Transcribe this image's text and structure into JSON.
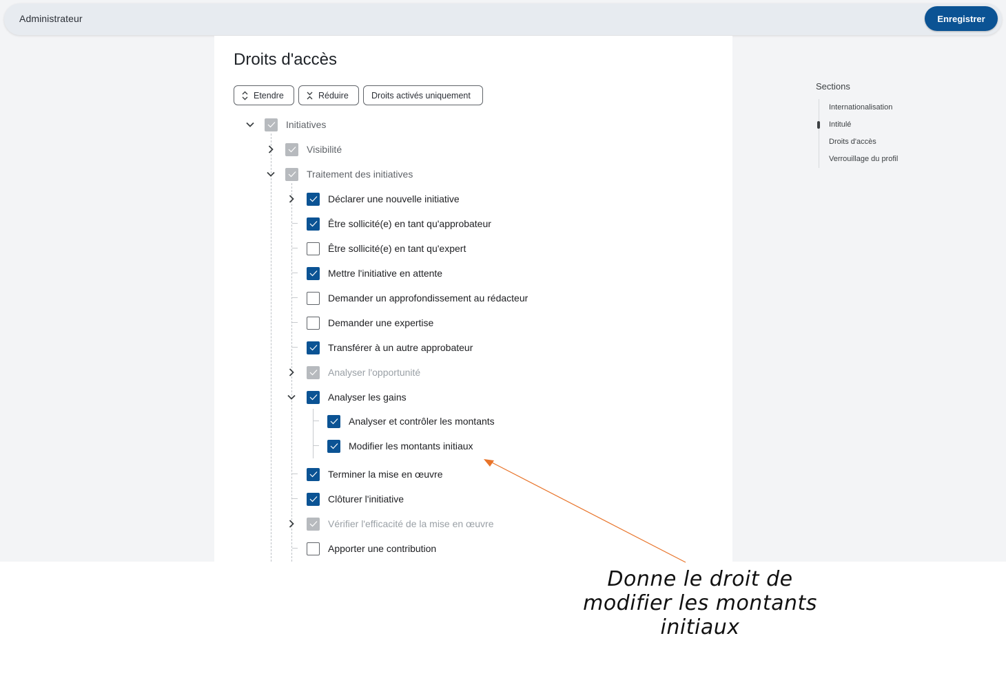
{
  "header": {
    "title": "Administrateur",
    "save_label": "Enregistrer"
  },
  "page": {
    "title": "Droits d'accès"
  },
  "toolbar": {
    "expand_label": "Etendre",
    "collapse_label": "Réduire",
    "active_only_label": "Droits activés uniquement"
  },
  "tree": [
    {
      "label": "Initiatives",
      "state": "grey",
      "chevron": "down",
      "level": 0
    },
    {
      "label": "Visibilité",
      "state": "grey",
      "chevron": "right",
      "level": 1
    },
    {
      "label": "Traitement des initiatives",
      "state": "grey",
      "chevron": "down",
      "level": 1
    },
    {
      "label": "Déclarer une nouvelle initiative",
      "state": "checked",
      "chevron": "right",
      "level": 2
    },
    {
      "label": "Être sollicité(e) en tant qu'approbateur",
      "state": "checked",
      "chevron": "",
      "level": 2
    },
    {
      "label": "Être sollicité(e) en tant qu'expert",
      "state": "unchecked",
      "chevron": "",
      "level": 2
    },
    {
      "label": "Mettre l'initiative en attente",
      "state": "checked",
      "chevron": "",
      "level": 2
    },
    {
      "label": "Demander un approfondissement au rédacteur",
      "state": "unchecked",
      "chevron": "",
      "level": 2
    },
    {
      "label": "Demander une expertise",
      "state": "unchecked",
      "chevron": "",
      "level": 2
    },
    {
      "label": "Transférer à un autre approbateur",
      "state": "checked",
      "chevron": "",
      "level": 2
    },
    {
      "label": "Analyser l'opportunité",
      "state": "disabled",
      "chevron": "right",
      "level": 2
    },
    {
      "label": "Analyser les gains",
      "state": "checked",
      "chevron": "down",
      "level": 2
    },
    {
      "label": "Analyser et contrôler les montants",
      "state": "checked",
      "chevron": "",
      "level": 3
    },
    {
      "label": "Modifier les montants initiaux",
      "state": "checked",
      "chevron": "",
      "level": 3
    },
    {
      "label": "Terminer la mise en œuvre",
      "state": "checked",
      "chevron": "",
      "level": 2
    },
    {
      "label": "Clôturer l'initiative",
      "state": "checked",
      "chevron": "",
      "level": 2
    },
    {
      "label": "Vérifier l'efficacité de la mise en œuvre",
      "state": "disabled",
      "chevron": "right",
      "level": 2
    },
    {
      "label": "Apporter une contribution",
      "state": "unchecked",
      "chevron": "",
      "level": 2
    }
  ],
  "sections": {
    "heading": "Sections",
    "items": [
      "Internationalisation",
      "Intitulé",
      "Droits d'accès",
      "Verrouillage du profil"
    ],
    "active_index": 1
  },
  "annotation": {
    "line1": "Donne le droit de",
    "line2": "modifier les montants",
    "line3": "initiaux",
    "color": "#e8742a"
  },
  "colors": {
    "accent": "#0b5394",
    "checkbox_disabled": "#b7babe"
  }
}
